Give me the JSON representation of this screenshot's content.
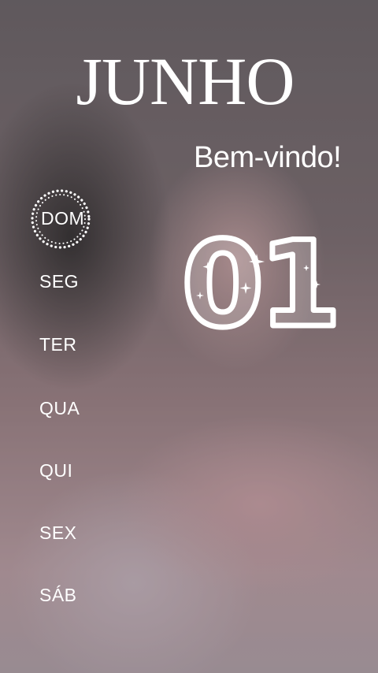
{
  "calendar": {
    "month": "JUNHO",
    "welcome": "Bem-vindo!",
    "day": "01",
    "weekdays": [
      "DOM",
      "SEG",
      "TER",
      "QUA",
      "QUI",
      "SEX",
      "SÁB"
    ],
    "active_weekday": "DOM"
  },
  "colors": {
    "text": "#ffffff",
    "overlay_fill": "rgba(255,255,255,0.18)"
  },
  "icons": {
    "active_day_marker": "dotted-circle-icon",
    "sparkles": "sparkle-icon"
  }
}
